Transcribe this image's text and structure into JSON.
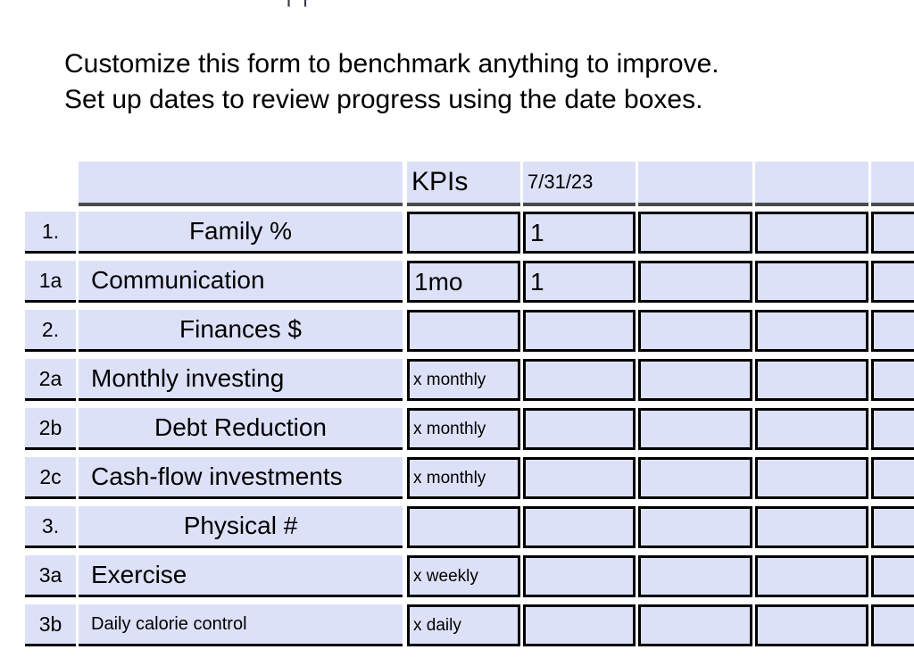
{
  "top_clipped_text": "| |",
  "intro": {
    "line1": "Customize this form to benchmark anything to improve.",
    "line2": "Set up dates to review progress using the date boxes."
  },
  "table": {
    "columns": {
      "number": "",
      "label": "",
      "kpis": "KPIs",
      "date1": "7/31/23",
      "date2": "",
      "date3": "",
      "date4": ""
    },
    "rows": [
      {
        "num": "1.",
        "label": "Family %",
        "kpi": "",
        "d1": "1",
        "d2": "",
        "d3": "",
        "d4": "",
        "style": "section"
      },
      {
        "num": "1a",
        "label": "Communication",
        "kpi": "1mo",
        "d1": "1",
        "d2": "",
        "d3": "",
        "d4": "",
        "style": "item"
      },
      {
        "num": "2.",
        "label": "Finances $",
        "kpi": "",
        "d1": "",
        "d2": "",
        "d3": "",
        "d4": "",
        "style": "section"
      },
      {
        "num": "2a",
        "label": "Monthly investing",
        "kpi": "x monthly",
        "d1": "",
        "d2": "",
        "d3": "",
        "d4": "",
        "style": "item"
      },
      {
        "num": "2b",
        "label": "Debt Reduction",
        "kpi": "x monthly",
        "d1": "",
        "d2": "",
        "d3": "",
        "d4": "",
        "style": "section"
      },
      {
        "num": "2c",
        "label": "Cash-flow investments",
        "kpi": "x monthly",
        "d1": "",
        "d2": "",
        "d3": "",
        "d4": "",
        "style": "item"
      },
      {
        "num": "3.",
        "label": "Physical #",
        "kpi": "",
        "d1": "",
        "d2": "",
        "d3": "",
        "d4": "",
        "style": "section"
      },
      {
        "num": "3a",
        "label": "Exercise",
        "kpi": "x weekly",
        "d1": "",
        "d2": "",
        "d3": "",
        "d4": "",
        "style": "item"
      },
      {
        "num": "3b",
        "label": "Daily calorie control",
        "kpi": "x daily",
        "d1": "",
        "d2": "",
        "d3": "",
        "d4": "",
        "style": "small"
      }
    ]
  },
  "colors": {
    "cell_fill": "#dde1f8",
    "grid_line": "#000000",
    "header_rule": "#4a4a4a",
    "page_background": "#ffffff"
  }
}
